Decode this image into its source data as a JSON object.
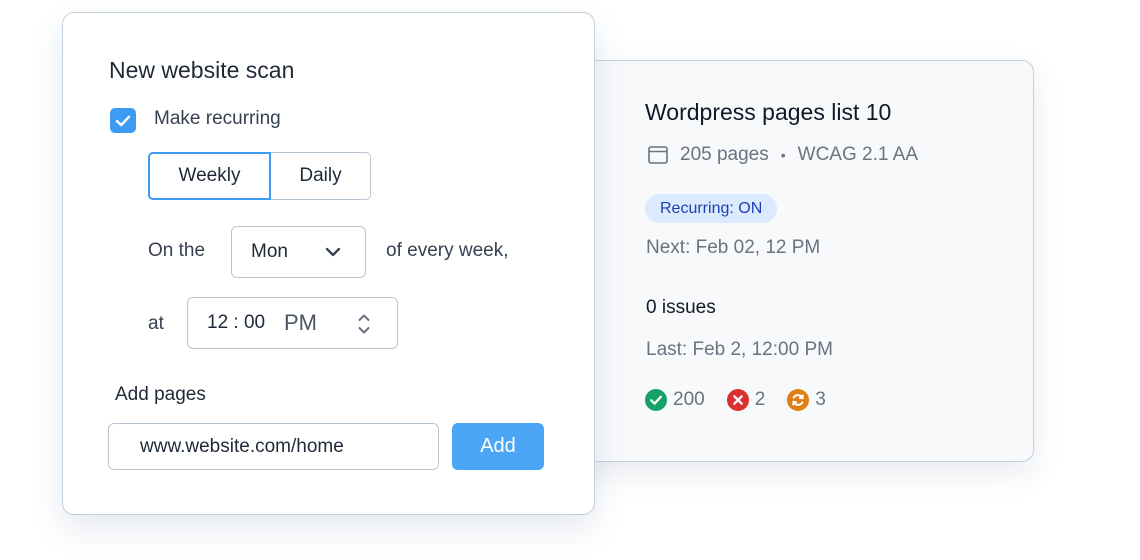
{
  "scan_form": {
    "title": "New website scan",
    "recurring": {
      "label": "Make recurring",
      "checked": true
    },
    "frequency_options": [
      "Weekly",
      "Daily"
    ],
    "frequency_selected": "Weekly",
    "on_the_label": "On the",
    "day_select": {
      "value": "Mon"
    },
    "every_week_label": "of every week,",
    "at_label": "at",
    "time": {
      "value": "12 : 00",
      "meridiem": "PM"
    },
    "add_pages_label": "Add pages",
    "url_input_value": "www.website.com/home",
    "add_button_label": "Add"
  },
  "scan_summary": {
    "title": "Wordpress pages list 10",
    "pages": "205 pages",
    "separator": "•",
    "standard": "WCAG 2.1 AA",
    "recurring_badge": "Recurring: ON",
    "next_run": "Next: Feb 02, 12 PM",
    "issues": "0 issues",
    "last_run": "Last: Feb 2, 12:00 PM",
    "stats": {
      "passed": "200",
      "failed": "2",
      "pending": "3"
    }
  },
  "colors": {
    "accent": "#3b9cf2",
    "button": "#4aa6f4",
    "badge_bg": "#dbeafe",
    "badge_text": "#1e40af",
    "success": "#16a06a",
    "error": "#dc2f2f",
    "warning": "#e07f16"
  },
  "icons": {
    "checkbox": "check-icon",
    "day_select": "chevron-down-icon",
    "time_stepper": "stepper-icon",
    "pages": "browser-window-icon",
    "passed": "check-circle-icon",
    "failed": "x-circle-icon",
    "pending": "refresh-circle-icon"
  }
}
